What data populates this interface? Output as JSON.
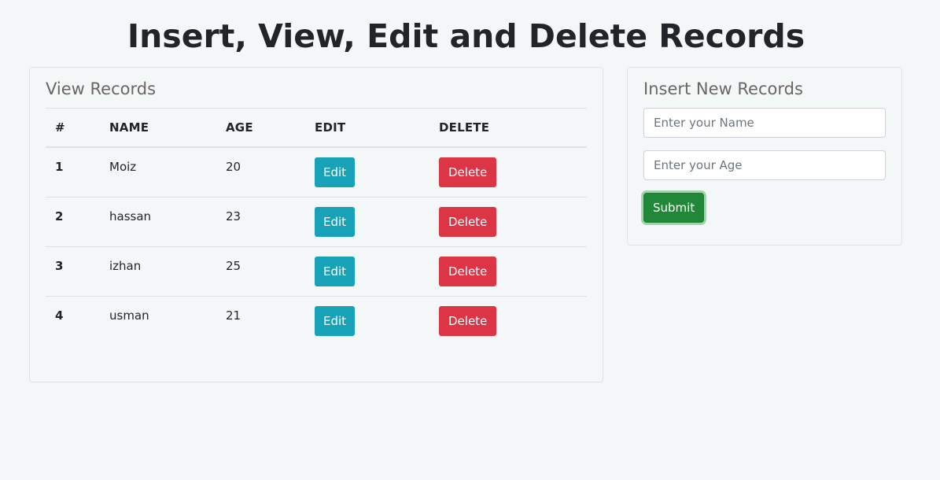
{
  "page": {
    "title": "Insert, View, Edit and Delete Records"
  },
  "view_panel": {
    "heading": "View Records",
    "columns": [
      "#",
      "NAME",
      "AGE",
      "EDIT",
      "DELETE"
    ],
    "rows": [
      {
        "id": "1",
        "name": "Moiz",
        "age": "20",
        "edit_label": "Edit",
        "delete_label": "Delete"
      },
      {
        "id": "2",
        "name": "hassan",
        "age": "23",
        "edit_label": "Edit",
        "delete_label": "Delete"
      },
      {
        "id": "3",
        "name": "izhan",
        "age": "25",
        "edit_label": "Edit",
        "delete_label": "Delete"
      },
      {
        "id": "4",
        "name": "usman",
        "age": "21",
        "edit_label": "Edit",
        "delete_label": "Delete"
      }
    ]
  },
  "insert_panel": {
    "heading": "Insert New Records",
    "name_field": {
      "value": "",
      "placeholder": "Enter your Name"
    },
    "age_field": {
      "value": "",
      "placeholder": "Enter your Age"
    },
    "submit_label": "Submit"
  },
  "colors": {
    "edit_button": "#17a2b8",
    "delete_button": "#dc3545",
    "submit_button": "#218838",
    "background": "#f4f7f8"
  }
}
